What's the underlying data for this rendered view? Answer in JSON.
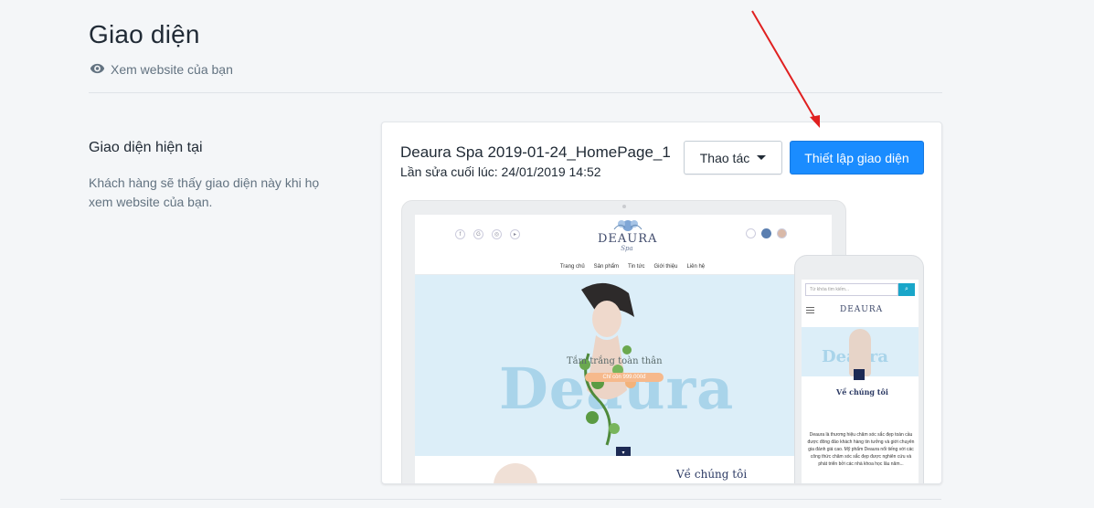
{
  "header": {
    "title": "Giao diện",
    "view_link": "Xem website của bạn"
  },
  "current_theme": {
    "section_title": "Giao diện hiện tại",
    "section_description": "Khách hàng sẽ thấy giao diện này khi họ xem website của bạn.",
    "theme_name": "Deaura Spa 2019-01-24_HomePage_1",
    "last_edited": "Lần sửa cuối lúc: 24/01/2019 14:52",
    "actions_label": "Thao tác",
    "setup_label": "Thiết lập giao diện"
  },
  "preview": {
    "logo_text": "DEAURA",
    "logo_sub": "Spa",
    "nav": [
      "Trang chủ",
      "Sản phẩm",
      "Tin tức",
      "Giới thiệu",
      "Liên hệ"
    ],
    "hero_watermark": "Deaura",
    "hero_headline": "Tắm trắng toàn thân",
    "hero_price": "Chỉ còn 999.000đ",
    "about_title": "Về chúng tôi",
    "phone_search_placeholder": "Từ khóa tìm kiếm...",
    "phone_about_title": "Về chúng tôi",
    "phone_about_text": "Deaura là thương hiệu chăm sóc sắc đẹp toàn cầu được đông đảo khách hàng tin tưởng và giới chuyên gia đánh giá cao. Mỹ phẩm Deaura nổi tiếng với các công thức chăm sóc sắc đẹp được nghiên cứu và phát triển bởi các nhà khoa học lâu năm..."
  },
  "colors": {
    "primary_button": "#1a8cff",
    "annotation_arrow": "#e02020",
    "background": "#f4f6f8"
  }
}
